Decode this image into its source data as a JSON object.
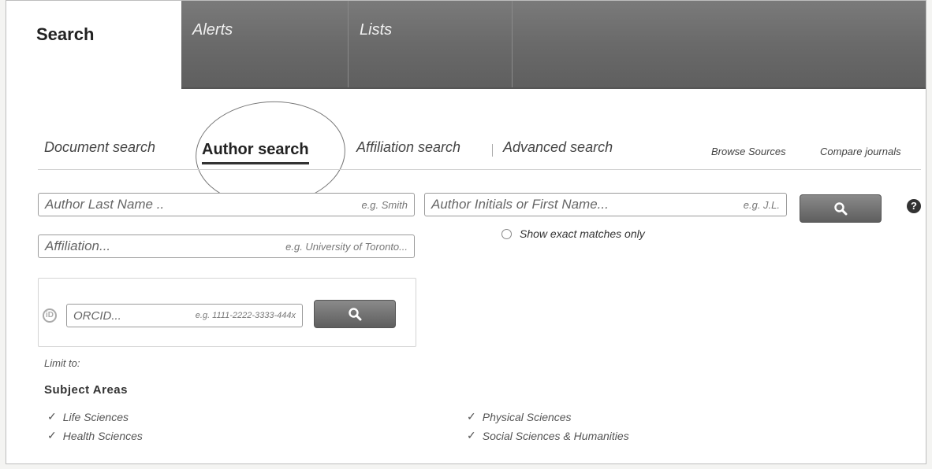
{
  "tabs": [
    {
      "label": "Search"
    },
    {
      "label": "Alerts"
    },
    {
      "label": "Lists"
    }
  ],
  "subnav": {
    "document": "Document search",
    "author": "Author search",
    "affiliation": "Affiliation search",
    "advanced": "Advanced search",
    "browse": "Browse Sources",
    "compare": "Compare journals"
  },
  "form": {
    "last_name_placeholder": "Author Last Name ..",
    "last_name_example": "e.g. Smith",
    "initials_placeholder": "Author Initials or First Name...",
    "initials_example": "e.g. J.L.",
    "affiliation_placeholder": "Affiliation...",
    "affiliation_example": "e.g. University of Toronto...",
    "exact_matches": "Show exact matches only",
    "orcid_placeholder": "ORCID...",
    "orcid_example": "e.g. 1111-2222-3333-444x",
    "help": "?"
  },
  "limit": {
    "label": "Limit to:",
    "subject_title": "Subject Areas",
    "subjects": [
      {
        "label": "Life Sciences",
        "checked": true
      },
      {
        "label": "Health Sciences",
        "checked": true
      },
      {
        "label": "Physical Sciences",
        "checked": true
      },
      {
        "label": "Social Sciences & Humanities",
        "checked": true
      }
    ]
  },
  "icons": {
    "search": "search-icon",
    "check": "check-icon",
    "orcid": "orcid-icon",
    "help": "help-icon"
  }
}
